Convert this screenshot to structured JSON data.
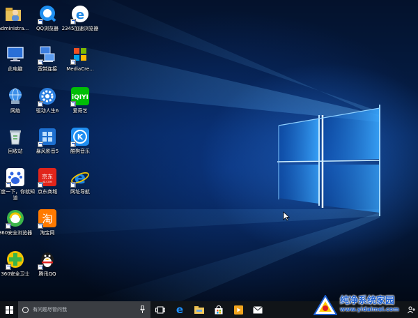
{
  "desktop": {
    "icons": [
      {
        "id": "administrator",
        "label": "Administra...",
        "icon": "user-folder-icon"
      },
      {
        "id": "qq-browser",
        "label": "QQ浏览器",
        "icon": "qq-browser-icon"
      },
      {
        "id": "browser-2345",
        "label": "2345加速浏览器",
        "icon": "browser-2345-icon"
      },
      {
        "id": "this-pc",
        "label": "此电脑",
        "icon": "computer-icon"
      },
      {
        "id": "broadband",
        "label": "宽带连接",
        "icon": "network-connection-icon"
      },
      {
        "id": "mediacreation",
        "label": "MediaCre...",
        "icon": "media-creation-icon"
      },
      {
        "id": "network",
        "label": "网络",
        "icon": "network-globe-icon"
      },
      {
        "id": "driver-life",
        "label": "驱动人生6",
        "icon": "gear-icon"
      },
      {
        "id": "iqiyi",
        "label": "爱奇艺",
        "icon": "iqiyi-icon"
      },
      {
        "id": "recycle-bin",
        "label": "回收站",
        "icon": "recycle-bin-icon"
      },
      {
        "id": "baofeng",
        "label": "暴风影音5",
        "icon": "baofeng-player-icon"
      },
      {
        "id": "kugou",
        "label": "酷狗音乐",
        "icon": "kugou-music-icon"
      },
      {
        "id": "baidu-zhidao",
        "label": "百度一下，你就知道",
        "icon": "baidu-paw-icon"
      },
      {
        "id": "jd",
        "label": "京东商城",
        "icon": "jd-icon"
      },
      {
        "id": "web-nav",
        "label": "网址导航",
        "icon": "internet-explorer-icon"
      },
      {
        "id": "browser-360",
        "label": "360安全浏览器",
        "icon": "browser-360-icon"
      },
      {
        "id": "taobao",
        "label": "淘宝网",
        "icon": "taobao-icon"
      },
      {
        "id": "guard-360",
        "label": "360安全卫士",
        "icon": "guard-360-icon"
      },
      {
        "id": "tencent-qq",
        "label": "腾讯QQ",
        "icon": "qq-penguin-icon"
      }
    ]
  },
  "taskbar": {
    "search_placeholder": "有问题尽管问我",
    "start_icon": "windows-logo-icon",
    "apps": [
      {
        "id": "task-view",
        "icon": "task-view-icon"
      },
      {
        "id": "edge",
        "icon": "edge-icon"
      },
      {
        "id": "file-explorer",
        "icon": "folder-icon"
      },
      {
        "id": "store",
        "icon": "store-bag-icon"
      },
      {
        "id": "media",
        "icon": "media-player-icon"
      },
      {
        "id": "mail",
        "icon": "mail-icon"
      }
    ]
  },
  "watermark": {
    "title": "纯净系统家园",
    "url": "www.yidaimei.com"
  },
  "colors": {
    "accent": "#1c5fd0",
    "taskbar": "#101418",
    "wallpaper_glow": "#3aa0ff"
  }
}
